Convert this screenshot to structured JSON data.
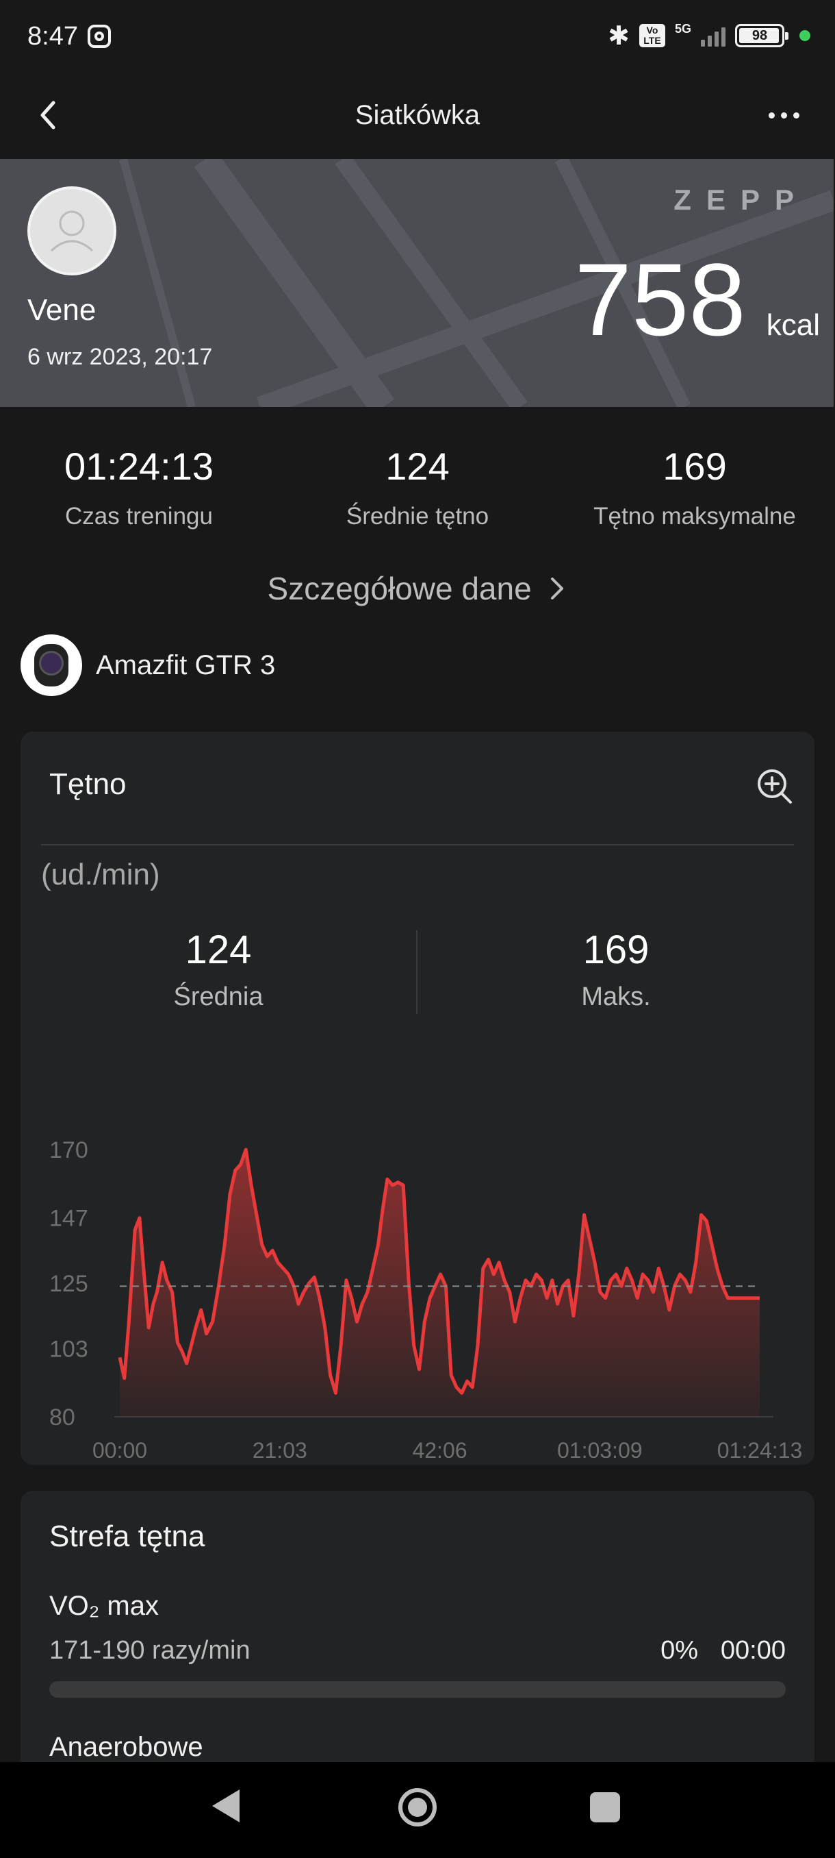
{
  "status_bar": {
    "time": "8:47",
    "battery": "98",
    "network": "5G",
    "volte": "Vo LTE"
  },
  "header": {
    "title": "Siatkówka"
  },
  "banner": {
    "user_name": "Vene",
    "date": "6 wrz 2023, 20:17",
    "brand": "ZEPP",
    "calories_value": "758",
    "calories_unit": "kcal"
  },
  "summary": [
    {
      "value": "01:24:13",
      "label": "Czas treningu"
    },
    {
      "value": "124",
      "label": "Średnie tętno"
    },
    {
      "value": "169",
      "label": "Tętno maksymalne"
    }
  ],
  "details_link": "Szczegółowe dane",
  "device": {
    "name": "Amazfit GTR 3"
  },
  "heart_rate": {
    "title": "Tętno",
    "unit": "(ud./min)",
    "avg_value": "124",
    "avg_label": "Średnia",
    "max_value": "169",
    "max_label": "Maks."
  },
  "chart_data": {
    "type": "area",
    "title": "",
    "xlabel": "",
    "ylabel": "",
    "ylim": [
      80,
      170
    ],
    "y_ticks": [
      "170",
      "147",
      "125",
      "103",
      "80"
    ],
    "y_tick_values": [
      170,
      147,
      125,
      103,
      80
    ],
    "x_ticks": [
      "00:00",
      "21:03",
      "42:06",
      "01:03:09",
      "01:24:13"
    ],
    "x_range_minutes": [
      0,
      84.2
    ],
    "reference_line": 124,
    "color": "#e83a3a",
    "series": [
      {
        "x": [
          0,
          0.6,
          1.2,
          2.0,
          2.6,
          3.2,
          3.8,
          4.4,
          4.9,
          5.6,
          6.2,
          6.9,
          7.6,
          8.2,
          8.8,
          9.4,
          10.0,
          10.7,
          11.4,
          12.2,
          13.0,
          13.8,
          14.5,
          15.2,
          15.9,
          16.6,
          17.3,
          18.0,
          18.7,
          19.4,
          20.1,
          20.8,
          21.5,
          22.2,
          22.9,
          23.5,
          24.2,
          24.9,
          25.6,
          26.3,
          27.0,
          27.7,
          28.4,
          29.1,
          29.8,
          30.5,
          31.2,
          31.9,
          32.6,
          33.3,
          34.0,
          34.6,
          35.2,
          35.9,
          36.6,
          37.3,
          38.0,
          38.7,
          39.4,
          40.1,
          40.8,
          41.5,
          42.2,
          42.9,
          43.6,
          44.3,
          45.0,
          45.7,
          46.4,
          47.1,
          47.8,
          48.5,
          49.2,
          49.9,
          50.6,
          51.3,
          52.0,
          52.7,
          53.4,
          54.1,
          54.8,
          55.5,
          56.2,
          56.9,
          57.6,
          58.3,
          59.0,
          59.7,
          60.4,
          61.1,
          61.8,
          62.5,
          63.2,
          63.9,
          64.6,
          65.3,
          66.0,
          66.7,
          67.4,
          68.1,
          68.8,
          69.5,
          70.2,
          70.9,
          71.6,
          72.3,
          73.0,
          73.7,
          74.4,
          75.1,
          75.8,
          76.5,
          77.2,
          77.9,
          78.6,
          79.3,
          80.0,
          80.7,
          81.4,
          82.1,
          82.8,
          83.5,
          84.2
        ],
        "y": [
          100,
          93,
          112,
          143,
          147,
          128,
          110,
          118,
          122,
          132,
          126,
          122,
          105,
          102,
          98,
          104,
          110,
          116,
          108,
          112,
          124,
          138,
          155,
          163,
          165,
          170,
          158,
          148,
          138,
          134,
          136,
          132,
          130,
          128,
          124,
          118,
          122,
          125,
          127,
          120,
          110,
          94,
          88,
          104,
          126,
          120,
          112,
          118,
          122,
          130,
          138,
          150,
          160,
          158,
          159,
          158,
          126,
          104,
          96,
          112,
          120,
          124,
          128,
          124,
          94,
          90,
          88,
          92,
          90,
          104,
          130,
          133,
          128,
          132,
          126,
          122,
          112,
          120,
          126,
          124,
          128,
          126,
          120,
          126,
          118,
          124,
          126,
          114,
          128,
          148,
          140,
          132,
          122,
          120,
          126,
          128,
          124,
          130,
          126,
          120,
          128,
          126,
          122,
          130,
          124,
          116,
          124,
          128,
          126,
          122,
          132,
          148,
          146,
          138,
          130,
          124,
          120,
          120,
          120,
          120,
          120,
          120,
          120
        ]
      }
    ]
  },
  "zones": {
    "title": "Strefa tętna",
    "items": [
      {
        "name": "VO₂ max",
        "range": "171-190 razy/min",
        "percent": "0%",
        "percent_value": 0,
        "time": "00:00"
      },
      {
        "name": "Anaerobowe"
      }
    ]
  }
}
